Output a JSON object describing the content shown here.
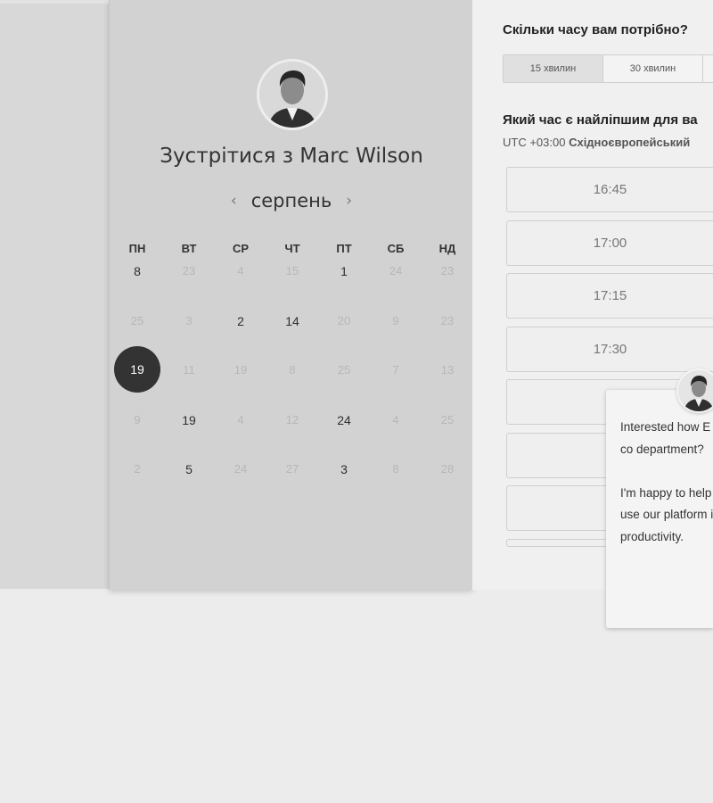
{
  "meeting": {
    "title": "Зустрітися з Marc Wilson",
    "month": "серпень",
    "prev_icon": "chevron-left-icon",
    "next_icon": "chevron-right-icon",
    "weekdays": [
      "ПН",
      "ВТ",
      "СР",
      "ЧТ",
      "ПТ",
      "СБ",
      "НД"
    ],
    "weeks": [
      [
        {
          "d": "8",
          "s": "dark"
        },
        {
          "d": "23",
          "s": "muted"
        },
        {
          "d": "4",
          "s": "muted"
        },
        {
          "d": "15",
          "s": "muted"
        },
        {
          "d": "1",
          "s": "dark"
        },
        {
          "d": "24",
          "s": "muted"
        },
        {
          "d": "23",
          "s": "muted"
        }
      ],
      [
        {
          "d": "25",
          "s": "muted"
        },
        {
          "d": "3",
          "s": "muted"
        },
        {
          "d": "2",
          "s": "dark"
        },
        {
          "d": "14",
          "s": "dark"
        },
        {
          "d": "20",
          "s": "muted"
        },
        {
          "d": "9",
          "s": "muted"
        },
        {
          "d": "23",
          "s": "muted"
        }
      ],
      [
        {
          "d": "19",
          "s": "selected"
        },
        {
          "d": "11",
          "s": "muted"
        },
        {
          "d": "19",
          "s": "muted"
        },
        {
          "d": "8",
          "s": "muted"
        },
        {
          "d": "25",
          "s": "muted"
        },
        {
          "d": "7",
          "s": "muted"
        },
        {
          "d": "13",
          "s": "muted"
        }
      ],
      [
        {
          "d": "9",
          "s": "muted"
        },
        {
          "d": "19",
          "s": "dark"
        },
        {
          "d": "4",
          "s": "muted"
        },
        {
          "d": "12",
          "s": "muted"
        },
        {
          "d": "24",
          "s": "dark"
        },
        {
          "d": "4",
          "s": "muted"
        },
        {
          "d": "25",
          "s": "muted"
        }
      ],
      [
        {
          "d": "2",
          "s": "muted"
        },
        {
          "d": "5",
          "s": "dark"
        },
        {
          "d": "24",
          "s": "muted"
        },
        {
          "d": "27",
          "s": "muted"
        },
        {
          "d": "3",
          "s": "dark"
        },
        {
          "d": "8",
          "s": "muted"
        },
        {
          "d": "28",
          "s": "muted"
        }
      ]
    ]
  },
  "booking": {
    "duration_question": "Скільки часу вам потрібно?",
    "durations": [
      {
        "label": "15 хвилин",
        "active": true
      },
      {
        "label": "30 хвилин",
        "active": false
      }
    ],
    "best_time_question": "Який час є найліпшим для ва",
    "timezone_offset": "UTC +03:00",
    "timezone_name": "Східноєвропейський",
    "slots": [
      "16:45",
      "17:00",
      "17:15",
      "17:30",
      "",
      "",
      ""
    ]
  },
  "chat": {
    "message": "Interested how E Management co department?\n\nI'm happy to help insight into how use our platform improvement in productivity."
  },
  "colors": {
    "selected_day": "#333333",
    "card_left": "#d2d2d2",
    "card_right": "#f0f0f0"
  }
}
